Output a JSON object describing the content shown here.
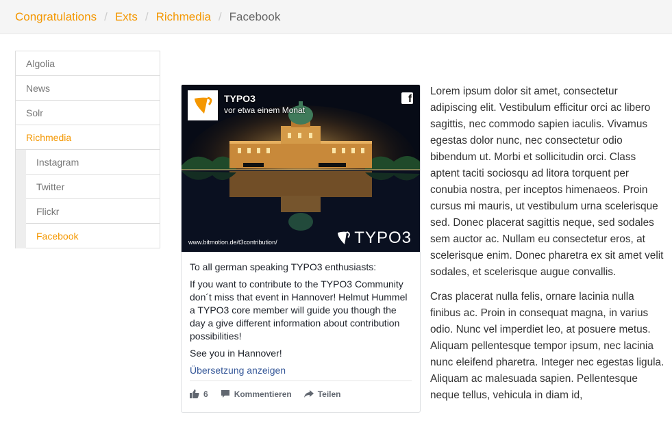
{
  "breadcrumb": {
    "items": [
      "Congratulations",
      "Exts",
      "Richmedia"
    ],
    "current": "Facebook",
    "separator": "/"
  },
  "sidebar": {
    "items": [
      "Algolia",
      "News",
      "Solr",
      "Richmedia"
    ],
    "subitems": [
      "Instagram",
      "Twitter",
      "Flickr",
      "Facebook"
    ],
    "active_item": "Richmedia",
    "active_subitem": "Facebook"
  },
  "facebook_post": {
    "page_name": "TYPO3",
    "time": "vor etwa einem Monat",
    "image_overlay_url": "www.bitmotion.de/t3contribution/",
    "image_brand": "TYPO3",
    "paragraphs": [
      "To all german speaking TYPO3 enthusiasts:",
      "If you want to contribute to the TYPO3 Community don´t miss that event in Hannover! Helmut Hummel a TYPO3 core member will guide you though the day a give different information about contribution possibilities!",
      "See you in Hannover!"
    ],
    "translate_link": "Übersetzung anzeigen",
    "likes": "6",
    "comment_label": "Kommentieren",
    "share_label": "Teilen"
  },
  "content": {
    "paragraphs": [
      "Lorem ipsum dolor sit amet, consectetur adipiscing elit. Vestibulum efficitur orci ac libero sagittis, nec commodo sapien iaculis. Vivamus egestas dolor nunc, nec consectetur odio bibendum ut. Morbi et sollicitudin orci. Class aptent taciti sociosqu ad litora torquent per conubia nostra, per inceptos himenaeos. Proin cursus mi mauris, ut vestibulum urna scelerisque sed. Donec placerat sagittis neque, sed sodales sem auctor ac. Nullam eu consectetur eros, at scelerisque enim. Donec pharetra ex sit amet velit sodales, et scelerisque augue convallis.",
      "Cras placerat nulla felis, ornare lacinia nulla finibus ac. Proin in consequat magna, in varius odio. Nunc vel imperdiet leo, at posuere metus. Aliquam pellentesque tempor ipsum, nec lacinia nunc eleifend pharetra. Integer nec egestas ligula. Aliquam ac malesuada sapien. Pellentesque neque tellus, vehicula in diam id,"
    ]
  },
  "colors": {
    "accent": "#f49700",
    "link_blue": "#365899"
  }
}
